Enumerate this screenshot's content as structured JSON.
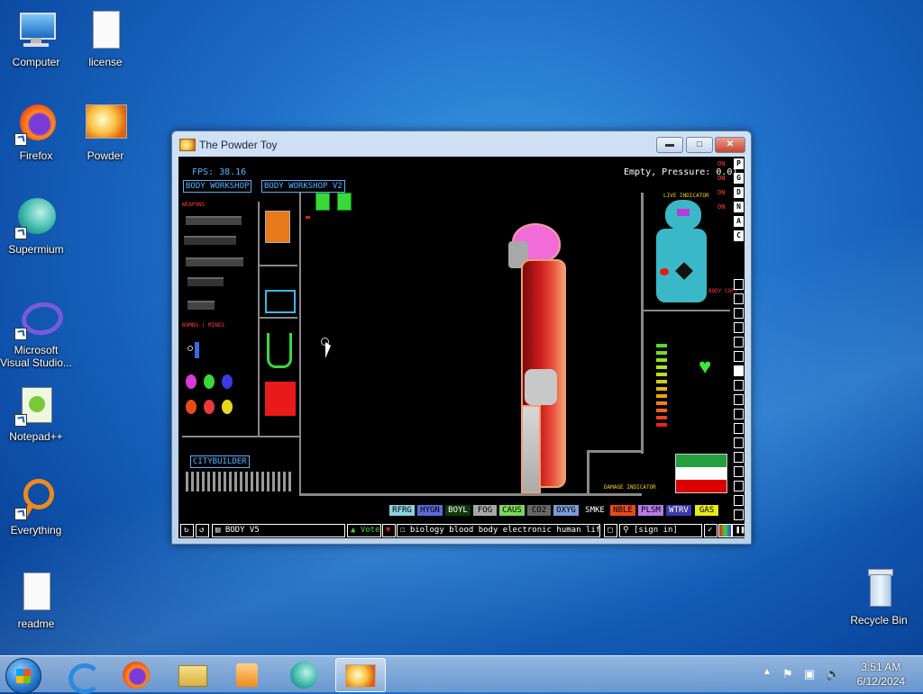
{
  "desktop": {
    "icons": [
      {
        "label": "Computer"
      },
      {
        "label": "license"
      },
      {
        "label": "Firefox"
      },
      {
        "label": "Powder"
      },
      {
        "label": "Supermium"
      },
      {
        "label": "Microsoft Visual Studio..."
      },
      {
        "label": "Notepad++"
      },
      {
        "label": "Everything"
      },
      {
        "label": "readme"
      },
      {
        "label": "Recycle Bin"
      }
    ]
  },
  "window": {
    "title": "The Powder Toy",
    "minimize_icon": "minimize-icon",
    "maximize_icon": "maximize-icon",
    "close_icon": "close-icon"
  },
  "game": {
    "fps": "FPS: 38.16",
    "pressure": "Empty, Pressure: 0.01",
    "tabs": [
      "BODY WORKSHOP",
      "BODY WORKSHOP V2"
    ],
    "weapons_label": "WEAPONS",
    "bombs_label": "BOMBS | MINES",
    "citybuilder_label": "CITYBUILDER",
    "live_indicator": "LIVE INDICATOR",
    "body_copy": "BODY COPY",
    "damage_indicator": "DAMAGE INDICATOR",
    "on_labels": [
      "ON",
      "ON",
      "ON",
      "ON"
    ],
    "menu_letters": [
      "P",
      "G",
      "D",
      "N",
      "A",
      "C"
    ],
    "elements": [
      {
        "label": "RFRG",
        "bg": "#8ad4e0",
        "fg": "#000"
      },
      {
        "label": "HYGN",
        "bg": "#5a6ad8",
        "fg": "#000"
      },
      {
        "label": "BOYL",
        "bg": "#0a3a0a",
        "fg": "#fff"
      },
      {
        "label": "FOG",
        "bg": "#a8a8a8",
        "fg": "#000"
      },
      {
        "label": "CAUS",
        "bg": "#7ad85a",
        "fg": "#000"
      },
      {
        "label": "CO2",
        "bg": "#666666",
        "fg": "#000"
      },
      {
        "label": "OXYG",
        "bg": "#7a9ad8",
        "fg": "#000"
      },
      {
        "label": "SMKE",
        "bg": "#000000",
        "fg": "#fff"
      },
      {
        "label": "NBLE",
        "bg": "#e84a1a",
        "fg": "#000"
      },
      {
        "label": "PLSM",
        "bg": "#b87ae8",
        "fg": "#000"
      },
      {
        "label": "WTRV",
        "bg": "#3a3aa8",
        "fg": "#fff"
      },
      {
        "label": "GAS",
        "bg": "#e8e81a",
        "fg": "#000"
      }
    ],
    "bottom": {
      "save_name": "BODY V5",
      "vote_label": "Vote",
      "tags": "biology blood body electronic human life...",
      "sign_in": "[sign in]"
    }
  },
  "taskbar": {
    "time": "3:51 AM",
    "date": "6/12/2024",
    "pinned": [
      "start-button",
      "internet-explorer",
      "firefox",
      "file-explorer",
      "media-player",
      "supermium",
      "powder-toy"
    ]
  }
}
